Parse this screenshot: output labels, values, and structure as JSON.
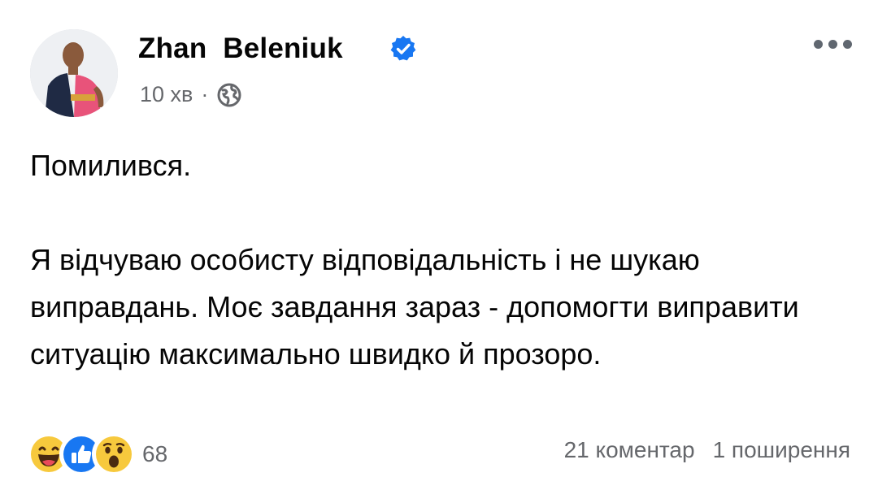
{
  "post": {
    "author": "Zhan  Beleniuk",
    "time": "10 хв",
    "separator": "·",
    "privacy_icon": "globe-icon",
    "verified_icon": "verified-badge-icon",
    "more_icon": "more-options-icon",
    "text": [
      "Помилився.",
      "Я відчуваю особисту відповідальність і не шукаю виправдань. Моє завдання зараз - допомогти виправити ситуацію максимально швидко й прозоро."
    ],
    "reactions": {
      "icons": [
        "haha-reaction-icon",
        "like-reaction-icon",
        "wow-reaction-icon"
      ],
      "count": "68"
    },
    "comments": "21 коментар",
    "shares": "1 поширення"
  },
  "colors": {
    "verified": "#1877f2",
    "secondary_text": "#65676b",
    "like_blue": "#1877f2",
    "emoji_yellow": "#f7c93d"
  }
}
